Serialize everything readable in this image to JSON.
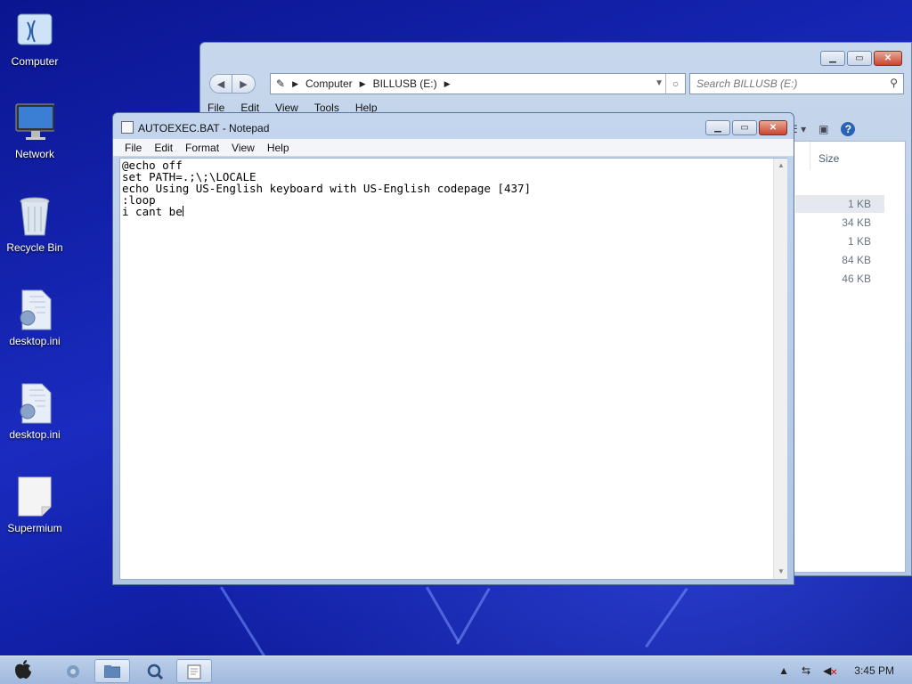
{
  "desktop": {
    "icons": [
      {
        "label": "Computer",
        "icon": "computer-icon"
      },
      {
        "label": "Network",
        "icon": "network-monitor-icon"
      },
      {
        "label": "Recycle Bin",
        "icon": "recycle-bin-icon"
      },
      {
        "label": "desktop.ini",
        "icon": "settings-file-icon"
      },
      {
        "label": "desktop.ini",
        "icon": "settings-file-icon"
      },
      {
        "label": "Supermium",
        "icon": "blank-file-icon"
      }
    ]
  },
  "explorer": {
    "address": {
      "segments": [
        "Computer",
        "BILLUSB (E:)"
      ]
    },
    "search_placeholder": "Search BILLUSB (E:)",
    "menu": [
      "File",
      "Edit",
      "View",
      "Tools",
      "Help"
    ],
    "columns": {
      "size": "Size"
    },
    "sizes": [
      "1 KB",
      "34 KB",
      "1 KB",
      "84 KB",
      "46 KB"
    ]
  },
  "notepad": {
    "title": "AUTOEXEC.BAT - Notepad",
    "menu": [
      "File",
      "Edit",
      "Format",
      "View",
      "Help"
    ],
    "lines": [
      "@echo off",
      "set PATH=.;\\;\\LOCALE",
      "echo Using US-English keyboard with US-English codepage [437]",
      ":loop",
      "i cant be"
    ]
  },
  "taskbar": {
    "clock": "3:45 PM",
    "items": [
      "apple-start-icon",
      "chrome-icon",
      "explorer-folder-icon",
      "search-icon",
      "notepad-icon"
    ]
  },
  "colors": {
    "desktop_bg": "#1a2bbf",
    "taskbar": "#a9c0e0",
    "close_button": "#c9452f"
  }
}
